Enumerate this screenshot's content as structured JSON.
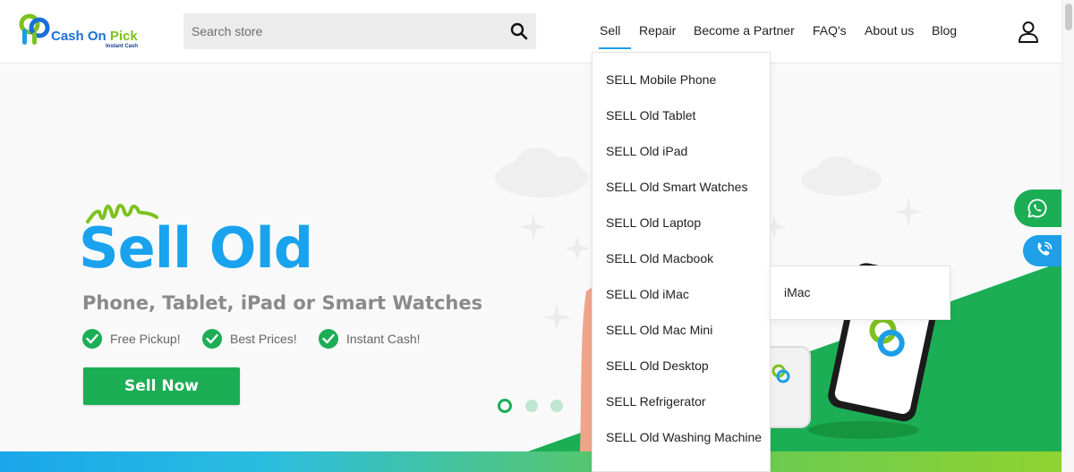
{
  "brand": {
    "name_part1": "Cash On",
    "name_part2": "Pick",
    "tagline": "Instant Cash",
    "colors": {
      "blue": "#1a6fd9",
      "green": "#7dc21e"
    }
  },
  "search": {
    "placeholder": "Search store",
    "icon": "search-icon"
  },
  "nav": {
    "items": [
      {
        "label": "Sell",
        "active": true
      },
      {
        "label": "Repair"
      },
      {
        "label": "Become a Partner"
      },
      {
        "label": "FAQ's"
      },
      {
        "label": "About us"
      },
      {
        "label": "Blog"
      }
    ],
    "user_icon": "user-icon"
  },
  "hero": {
    "title": "Sell Old",
    "subtitle": "Phone, Tablet, iPad or Smart Watches",
    "features": [
      "Free Pickup!",
      "Best Prices!",
      "Instant Cash!"
    ],
    "cta_label": "Sell Now",
    "slides": {
      "count": 3,
      "active": 1
    },
    "colors": {
      "title": "#19a3ee",
      "accent_green": "#1cae55"
    }
  },
  "dropdown": {
    "items": [
      "SELL Mobile Phone",
      "SELL Old Tablet",
      "SELL Old iPad",
      "SELL Old Smart Watches",
      "SELL Old Laptop",
      "SELL Old Macbook",
      "SELL Old iMac",
      "SELL Old Mac Mini",
      "SELL Old Desktop",
      "SELL Refrigerator",
      "SELL Old Washing Machine"
    ],
    "submenu_items": [
      "iMac"
    ]
  },
  "floating": {
    "whatsapp_icon": "whatsapp-icon",
    "call_icon": "phone-icon"
  }
}
